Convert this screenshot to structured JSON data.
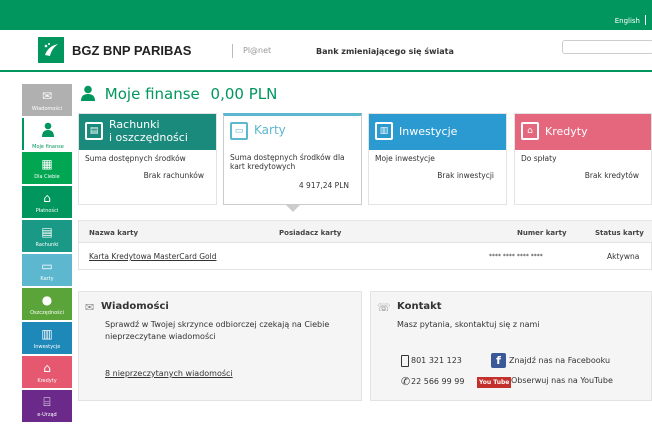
{
  "topbar": {
    "language": "English"
  },
  "header": {
    "brand": "BGZ BNP PARIBAS",
    "sub_brand": "Pl@net",
    "tagline": "Bank zmieniającego się świata"
  },
  "sidebar": {
    "items": [
      {
        "label": "Wiadomości",
        "icon": "envelope-icon",
        "color": "#b0b0b0"
      },
      {
        "label": "Moje finanse",
        "icon": "person-icon",
        "color": "#ffffff"
      },
      {
        "label": "Dla Ciebie",
        "icon": "gift-icon",
        "color": "#00a651"
      },
      {
        "label": "Płatności",
        "icon": "money-icon",
        "color": "#00965e"
      },
      {
        "label": "Rachunki",
        "icon": "account-icon",
        "color": "#1a9a86"
      },
      {
        "label": "Karty",
        "icon": "card-icon",
        "color": "#5db7cf"
      },
      {
        "label": "Oszczędności",
        "icon": "piggy-icon",
        "color": "#5aa43a"
      },
      {
        "label": "Inwestycje",
        "icon": "chart-icon",
        "color": "#1e88b8"
      },
      {
        "label": "Kredyty",
        "icon": "house-icon",
        "color": "#e5586f"
      },
      {
        "label": "e-Urząd",
        "icon": "bank-icon",
        "color": "#6b2a8a"
      }
    ]
  },
  "summary": {
    "title": "Moje finanse",
    "amount": "0,00 PLN"
  },
  "tiles": [
    {
      "title_line1": "Rachunki",
      "title_line2": "i oszczędności",
      "subtitle": "Suma dostępnych środków",
      "value": "Brak rachunków",
      "color": "#1a8a7c"
    },
    {
      "title_line1": "Karty",
      "title_line2": "",
      "subtitle_line1": "Suma dostępnych środków dla",
      "subtitle_line2": "kart kredytowych",
      "value": "4 917,24 PLN",
      "color": "#5db7cf"
    },
    {
      "title_line1": "Inwestycje",
      "title_line2": "",
      "subtitle": "Moje inwestycje",
      "value": "Brak inwestycji",
      "color": "#2a9ad0"
    },
    {
      "title_line1": "Kredyty",
      "title_line2": "",
      "subtitle": "Do spłaty",
      "value": "Brak kredytów",
      "color": "#e5677e"
    }
  ],
  "cards_table": {
    "headers": [
      "Nazwa karty",
      "Posiadacz karty",
      "Numer karty",
      "Status karty"
    ],
    "rows": [
      {
        "name": "Karta Kredytowa MasterCard Gold",
        "holder": "",
        "number": "**** **** **** ****",
        "status": "Aktywna"
      }
    ]
  },
  "messages": {
    "title": "Wiadomości",
    "text_line1": "Sprawdź w Twojej skrzynce odbiorczej czekają na Ciebie",
    "text_line2": "nieprzeczytane wiadomości",
    "link": "8 nieprzeczytanych wiadomości"
  },
  "contact": {
    "title": "Kontakt",
    "text": "Masz pytania, skontaktuj się z nami",
    "mobile_phone": "801 321 123",
    "phone": "22 566 99 99",
    "facebook": "Znajdź nas na Facebooku",
    "youtube": "Obserwuj nas na YouTube",
    "youtube_badge": "You Tube"
  }
}
